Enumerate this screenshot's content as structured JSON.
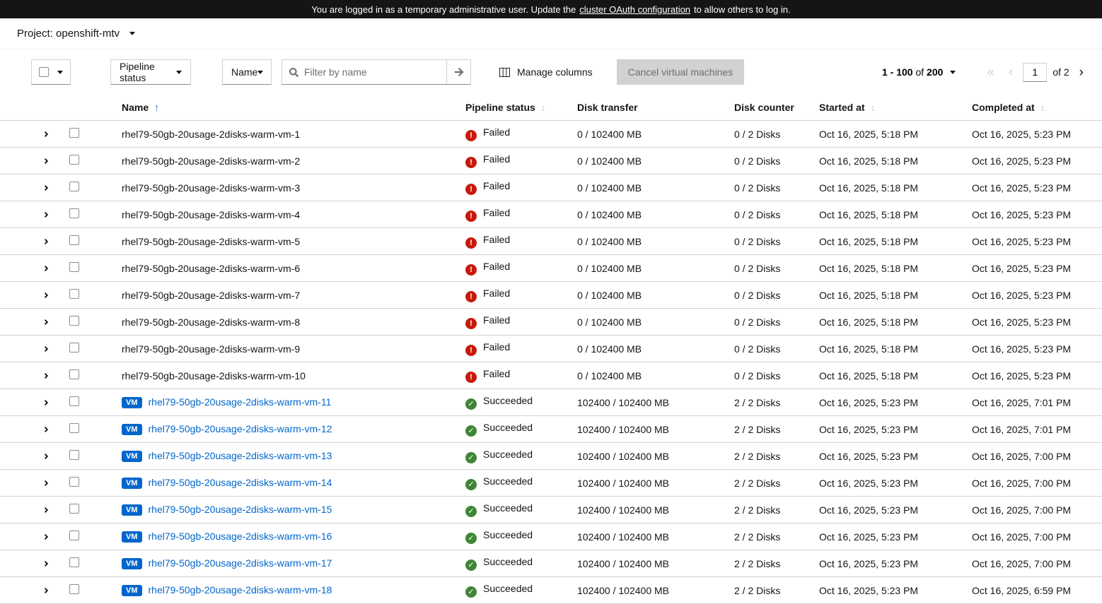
{
  "colors": {
    "failed": "#c9190b",
    "succeeded": "#3e8635",
    "link": "#0066cc",
    "badge": "#0066cc"
  },
  "banner": {
    "text_before": "You are logged in as a temporary administrative user. Update the",
    "link_text": "cluster OAuth configuration",
    "text_after": "to allow others to log in."
  },
  "project_selector": {
    "label": "Project: openshift-mtv"
  },
  "toolbar": {
    "pipeline_status_dropdown": "Pipeline status",
    "name_dropdown": "Name",
    "filter_placeholder": "Filter by name",
    "manage_columns_label": "Manage columns",
    "cancel_vms_label": "Cancel virtual machines",
    "pagination": {
      "range": "1 - 100",
      "of_word": "of",
      "total": "200",
      "current_page": "1",
      "page_count_label": "of 2"
    }
  },
  "table": {
    "headers": {
      "name": "Name",
      "pipeline_status": "Pipeline status",
      "disk_transfer": "Disk transfer",
      "disk_counter": "Disk counter",
      "started_at": "Started at",
      "completed_at": "Completed at"
    },
    "icons": {
      "failed": "exclamation-circle",
      "succeeded": "check-circle"
    },
    "rows": [
      {
        "name": "rhel79-50gb-20usage-2disks-warm-vm-1",
        "badge": null,
        "status": "Failed",
        "transfer": "0 / 102400 MB",
        "counter": "0 / 2 Disks",
        "started": "Oct 16, 2025, 5:18 PM",
        "completed": "Oct 16, 2025, 5:23 PM"
      },
      {
        "name": "rhel79-50gb-20usage-2disks-warm-vm-2",
        "badge": null,
        "status": "Failed",
        "transfer": "0 / 102400 MB",
        "counter": "0 / 2 Disks",
        "started": "Oct 16, 2025, 5:18 PM",
        "completed": "Oct 16, 2025, 5:23 PM"
      },
      {
        "name": "rhel79-50gb-20usage-2disks-warm-vm-3",
        "badge": null,
        "status": "Failed",
        "transfer": "0 / 102400 MB",
        "counter": "0 / 2 Disks",
        "started": "Oct 16, 2025, 5:18 PM",
        "completed": "Oct 16, 2025, 5:23 PM"
      },
      {
        "name": "rhel79-50gb-20usage-2disks-warm-vm-4",
        "badge": null,
        "status": "Failed",
        "transfer": "0 / 102400 MB",
        "counter": "0 / 2 Disks",
        "started": "Oct 16, 2025, 5:18 PM",
        "completed": "Oct 16, 2025, 5:23 PM"
      },
      {
        "name": "rhel79-50gb-20usage-2disks-warm-vm-5",
        "badge": null,
        "status": "Failed",
        "transfer": "0 / 102400 MB",
        "counter": "0 / 2 Disks",
        "started": "Oct 16, 2025, 5:18 PM",
        "completed": "Oct 16, 2025, 5:23 PM"
      },
      {
        "name": "rhel79-50gb-20usage-2disks-warm-vm-6",
        "badge": null,
        "status": "Failed",
        "transfer": "0 / 102400 MB",
        "counter": "0 / 2 Disks",
        "started": "Oct 16, 2025, 5:18 PM",
        "completed": "Oct 16, 2025, 5:23 PM"
      },
      {
        "name": "rhel79-50gb-20usage-2disks-warm-vm-7",
        "badge": null,
        "status": "Failed",
        "transfer": "0 / 102400 MB",
        "counter": "0 / 2 Disks",
        "started": "Oct 16, 2025, 5:18 PM",
        "completed": "Oct 16, 2025, 5:23 PM"
      },
      {
        "name": "rhel79-50gb-20usage-2disks-warm-vm-8",
        "badge": null,
        "status": "Failed",
        "transfer": "0 / 102400 MB",
        "counter": "0 / 2 Disks",
        "started": "Oct 16, 2025, 5:18 PM",
        "completed": "Oct 16, 2025, 5:23 PM"
      },
      {
        "name": "rhel79-50gb-20usage-2disks-warm-vm-9",
        "badge": null,
        "status": "Failed",
        "transfer": "0 / 102400 MB",
        "counter": "0 / 2 Disks",
        "started": "Oct 16, 2025, 5:18 PM",
        "completed": "Oct 16, 2025, 5:23 PM"
      },
      {
        "name": "rhel79-50gb-20usage-2disks-warm-vm-10",
        "badge": null,
        "status": "Failed",
        "transfer": "0 / 102400 MB",
        "counter": "0 / 2 Disks",
        "started": "Oct 16, 2025, 5:18 PM",
        "completed": "Oct 16, 2025, 5:23 PM"
      },
      {
        "name": "rhel79-50gb-20usage-2disks-warm-vm-11",
        "badge": "VM",
        "status": "Succeeded",
        "transfer": "102400 / 102400 MB",
        "counter": "2 / 2 Disks",
        "started": "Oct 16, 2025, 5:23 PM",
        "completed": "Oct 16, 2025, 7:01 PM"
      },
      {
        "name": "rhel79-50gb-20usage-2disks-warm-vm-12",
        "badge": "VM",
        "status": "Succeeded",
        "transfer": "102400 / 102400 MB",
        "counter": "2 / 2 Disks",
        "started": "Oct 16, 2025, 5:23 PM",
        "completed": "Oct 16, 2025, 7:01 PM"
      },
      {
        "name": "rhel79-50gb-20usage-2disks-warm-vm-13",
        "badge": "VM",
        "status": "Succeeded",
        "transfer": "102400 / 102400 MB",
        "counter": "2 / 2 Disks",
        "started": "Oct 16, 2025, 5:23 PM",
        "completed": "Oct 16, 2025, 7:00 PM"
      },
      {
        "name": "rhel79-50gb-20usage-2disks-warm-vm-14",
        "badge": "VM",
        "status": "Succeeded",
        "transfer": "102400 / 102400 MB",
        "counter": "2 / 2 Disks",
        "started": "Oct 16, 2025, 5:23 PM",
        "completed": "Oct 16, 2025, 7:00 PM"
      },
      {
        "name": "rhel79-50gb-20usage-2disks-warm-vm-15",
        "badge": "VM",
        "status": "Succeeded",
        "transfer": "102400 / 102400 MB",
        "counter": "2 / 2 Disks",
        "started": "Oct 16, 2025, 5:23 PM",
        "completed": "Oct 16, 2025, 7:00 PM"
      },
      {
        "name": "rhel79-50gb-20usage-2disks-warm-vm-16",
        "badge": "VM",
        "status": "Succeeded",
        "transfer": "102400 / 102400 MB",
        "counter": "2 / 2 Disks",
        "started": "Oct 16, 2025, 5:23 PM",
        "completed": "Oct 16, 2025, 7:00 PM"
      },
      {
        "name": "rhel79-50gb-20usage-2disks-warm-vm-17",
        "badge": "VM",
        "status": "Succeeded",
        "transfer": "102400 / 102400 MB",
        "counter": "2 / 2 Disks",
        "started": "Oct 16, 2025, 5:23 PM",
        "completed": "Oct 16, 2025, 7:00 PM"
      },
      {
        "name": "rhel79-50gb-20usage-2disks-warm-vm-18",
        "badge": "VM",
        "status": "Succeeded",
        "transfer": "102400 / 102400 MB",
        "counter": "2 / 2 Disks",
        "started": "Oct 16, 2025, 5:23 PM",
        "completed": "Oct 16, 2025, 6:59 PM"
      }
    ]
  }
}
